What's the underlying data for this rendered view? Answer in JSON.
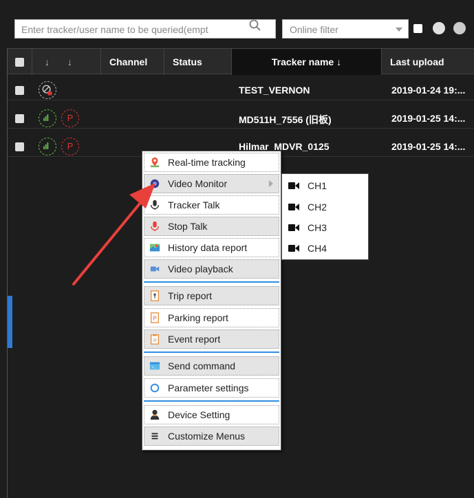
{
  "toolbar": {
    "search_placeholder": "Enter tracker/user name to be queried(empt",
    "filter_value": "Online filter"
  },
  "table": {
    "headers": {
      "sort1": "↓",
      "sort2": "↓",
      "channel": "Channel",
      "status": "Status",
      "tracker_name": "Tracker name ↓",
      "last_upload": "Last upload"
    },
    "rows": [
      {
        "name": "TEST_VERNON",
        "upload": "2019-01-24 19:..."
      },
      {
        "name": "MD511H_7556 (旧板)",
        "upload": "2019-01-25 14:..."
      },
      {
        "name": "Hilmar_MDVR_0125",
        "upload": "2019-01-25 14:..."
      }
    ]
  },
  "menu": {
    "items": [
      {
        "label": "Real-time tracking",
        "icon": "map-pin-icon"
      },
      {
        "label": "Video Monitor",
        "icon": "webcam-icon"
      },
      {
        "label": "Tracker Talk",
        "icon": "microphone-icon"
      },
      {
        "label": "Stop Talk",
        "icon": "microphone-red-icon"
      },
      {
        "label": "History data report",
        "icon": "map-report-icon"
      },
      {
        "label": "Video playback",
        "icon": "video-camera-icon"
      },
      {
        "label": "Trip report",
        "icon": "trip-report-icon"
      },
      {
        "label": "Parking report",
        "icon": "parking-report-icon"
      },
      {
        "label": "Event report",
        "icon": "event-report-icon"
      },
      {
        "label": "Send command",
        "icon": "terminal-icon"
      },
      {
        "label": "Parameter settings",
        "icon": "circle-icon"
      },
      {
        "label": "Device Setting",
        "icon": "user-settings-icon"
      },
      {
        "label": "Customize Menus",
        "icon": "list-icon"
      }
    ]
  },
  "submenu": {
    "channels": [
      "CH1",
      "CH2",
      "CH3",
      "CH4"
    ]
  },
  "colors": {
    "accent": "#2f8ee0",
    "arrow": "#e8403a",
    "signal": "#6bbf4e",
    "parking": "#d33333"
  }
}
